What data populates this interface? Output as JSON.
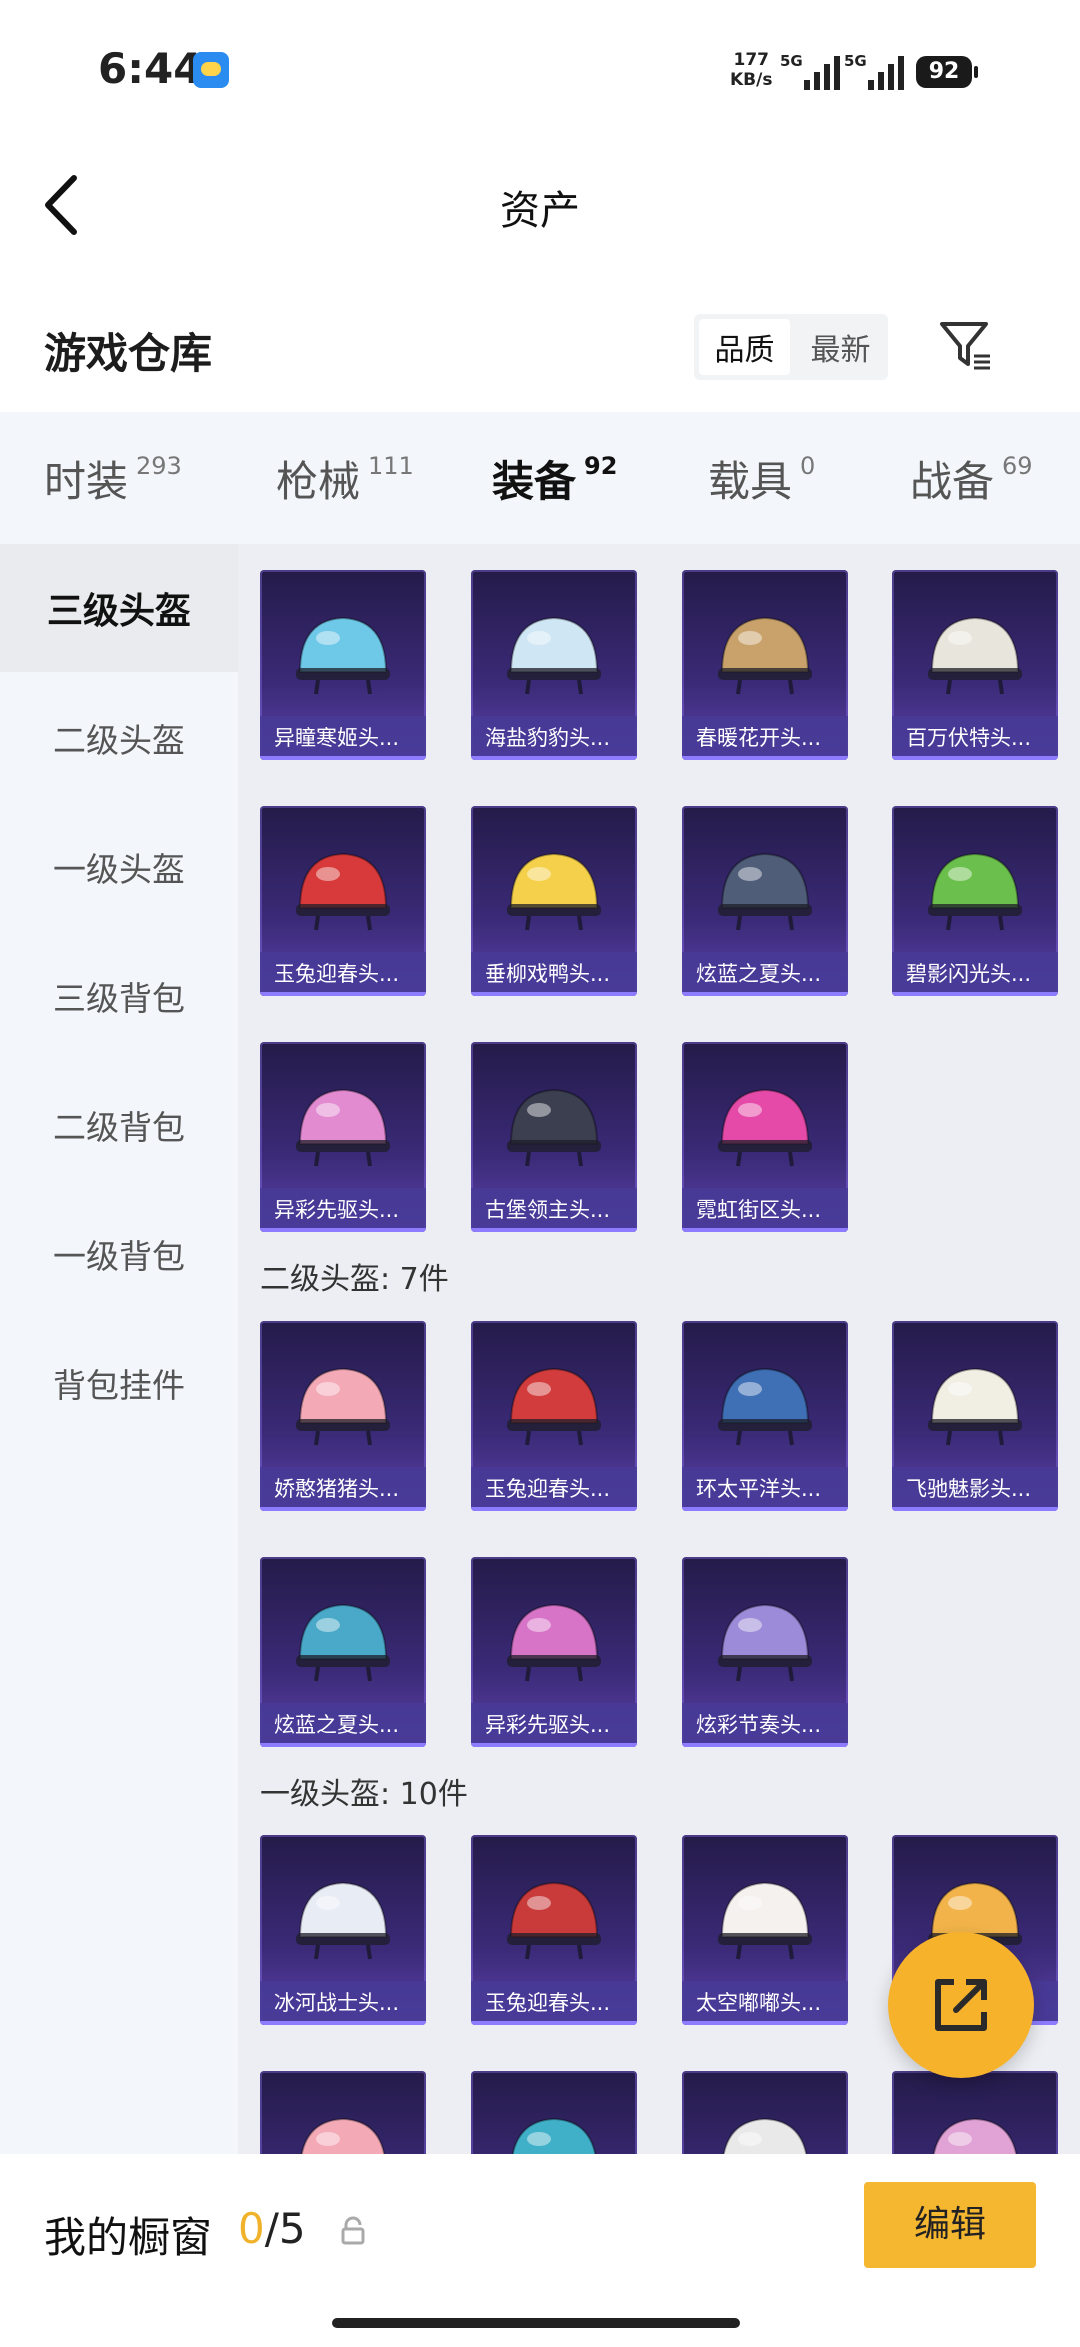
{
  "status": {
    "time": "6:44",
    "speed_value": "177",
    "speed_unit": "KB/s",
    "sim1": "5G",
    "sim2": "5G",
    "battery": "92"
  },
  "header": {
    "title": "资产"
  },
  "warehouse": {
    "title": "游戏仓库",
    "sort_options": [
      "品质",
      "最新"
    ],
    "sort_active": "品质"
  },
  "tabs": [
    {
      "label": "时装",
      "count": "293"
    },
    {
      "label": "枪械",
      "count": "111"
    },
    {
      "label": "装备",
      "count": "92",
      "active": true
    },
    {
      "label": "载具",
      "count": "0"
    },
    {
      "label": "战备",
      "count": "69"
    }
  ],
  "sidebar": [
    {
      "label": "三级头盔",
      "active": true
    },
    {
      "label": "二级头盔"
    },
    {
      "label": "一级头盔"
    },
    {
      "label": "三级背包"
    },
    {
      "label": "二级背包"
    },
    {
      "label": "一级背包"
    },
    {
      "label": "背包挂件"
    }
  ],
  "sections": {
    "level3": {
      "items": [
        {
          "name": "异瞳寒姬头...",
          "icon": "helmet-icon",
          "color": "#6ec9e8"
        },
        {
          "name": "海盐豹豹头...",
          "icon": "helmet-icon",
          "color": "#cfe6f4"
        },
        {
          "name": "春暖花开头...",
          "icon": "helmet-icon",
          "color": "#c8a26a"
        },
        {
          "name": "百万伏特头...",
          "icon": "helmet-icon",
          "color": "#e8e6dc"
        },
        {
          "name": "玉兔迎春头...",
          "icon": "helmet-icon",
          "color": "#d8393a"
        },
        {
          "name": "垂柳戏鸭头...",
          "icon": "helmet-icon",
          "color": "#f5d04a"
        },
        {
          "name": "炫蓝之夏头...",
          "icon": "helmet-icon",
          "color": "#4f5d79"
        },
        {
          "name": "碧影闪光头...",
          "icon": "helmet-icon",
          "color": "#6bbf4c"
        },
        {
          "name": "异彩先驱头...",
          "icon": "helmet-icon",
          "color": "#e38bd1"
        },
        {
          "name": "古堡领主头...",
          "icon": "helmet-icon",
          "color": "#3b3f50"
        },
        {
          "name": "霓虹街区头...",
          "icon": "helmet-icon",
          "color": "#e54aa8"
        }
      ]
    },
    "level2": {
      "title": "二级头盔: 7件",
      "items": [
        {
          "name": "娇憨猪猪头...",
          "icon": "helmet-icon",
          "color": "#f4aab6"
        },
        {
          "name": "玉兔迎春头...",
          "icon": "helmet-icon",
          "color": "#d23c3c"
        },
        {
          "name": "环太平洋头...",
          "icon": "helmet-icon",
          "color": "#3f6fb4"
        },
        {
          "name": "飞驰魅影头...",
          "icon": "helmet-icon",
          "color": "#f1efe4"
        },
        {
          "name": "炫蓝之夏头...",
          "icon": "helmet-icon",
          "color": "#4aa9c9"
        },
        {
          "name": "异彩先驱头...",
          "icon": "helmet-icon",
          "color": "#d774c8"
        },
        {
          "name": "炫彩节奏头...",
          "icon": "helmet-icon",
          "color": "#9b8bd8"
        }
      ]
    },
    "level1": {
      "title": "一级头盔: 10件",
      "items": [
        {
          "name": "冰河战士头...",
          "icon": "helmet-icon",
          "color": "#e8ecf5"
        },
        {
          "name": "玉兔迎春头...",
          "icon": "helmet-icon",
          "color": "#c93a3a"
        },
        {
          "name": "太空嘟嘟头...",
          "icon": "helmet-icon",
          "color": "#f5f1ef"
        },
        {
          "name": "",
          "icon": "helmet-icon",
          "color": "#f2b44a"
        },
        {
          "name": "",
          "icon": "helmet-icon",
          "color": "#f4aab6"
        },
        {
          "name": "",
          "icon": "helmet-icon",
          "color": "#40b0c9"
        },
        {
          "name": "",
          "icon": "helmet-icon",
          "color": "#e9e9e9"
        },
        {
          "name": "",
          "icon": "helmet-icon",
          "color": "#e1a2d6"
        }
      ]
    }
  },
  "fab": {
    "icon": "share-icon"
  },
  "bottom": {
    "label": "我的橱窗",
    "count_current": "0",
    "count_total": "/5",
    "edit_label": "编辑"
  }
}
